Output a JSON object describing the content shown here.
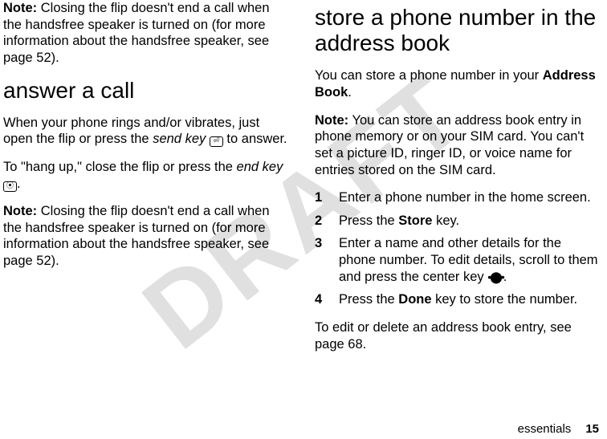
{
  "watermark": "DRAFT",
  "left": {
    "note1_label": "Note:",
    "note1_text": " Closing the flip doesn't end a call when the handsfree speaker is turned on (for more information about the handsfree speaker, see page 52).",
    "h_answer": "answer a call",
    "p_answer1a": "When your phone rings and/or vibrates, just open the flip or press the ",
    "p_answer1b": "send key",
    "p_answer1c": " to answer.",
    "p_hang1a": "To \"hang up,\" close the flip or press the ",
    "p_hang1b": "end key",
    "p_hang1c": ".",
    "note2_label": "Note:",
    "note2_text": " Closing the flip doesn't end a call when the handsfree speaker is turned on (for more information about the handsfree speaker, see page 52)."
  },
  "right": {
    "h_store": "store a phone number in the address book",
    "p_intro1": "You can store a phone number in your ",
    "p_intro2": "Address Book",
    "p_intro3": ".",
    "note_label": "Note:",
    "note_text": " You can store an address book entry in phone memory or on your SIM card. You can't set a picture ID, ringer ID, or voice name for entries stored on the SIM card.",
    "steps": [
      {
        "n": "1",
        "t": "Enter a phone number in the home screen."
      },
      {
        "n": "2",
        "t_a": "Press the ",
        "t_b": "Store",
        "t_c": " key."
      },
      {
        "n": "3",
        "t_a": "Enter a name and other details for the phone number. To edit details, scroll to them and press the center key ",
        "t_b": "•⬤•",
        "t_c": "."
      },
      {
        "n": "4",
        "t_a": "Press the ",
        "t_b": "Done",
        "t_c": " key to store the number."
      }
    ],
    "p_edit": "To edit or delete an address book entry, see page 68."
  },
  "footer": {
    "section": "essentials",
    "page": "15"
  }
}
